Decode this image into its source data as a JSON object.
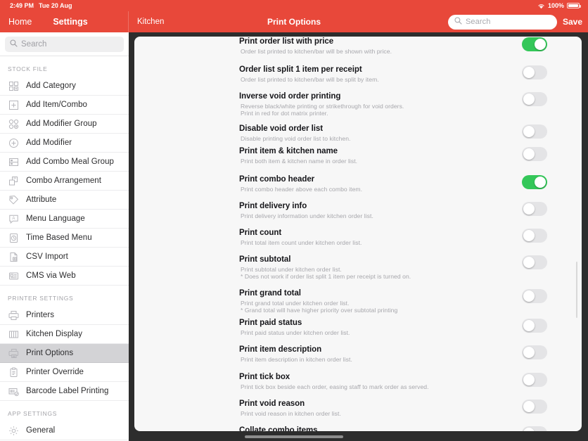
{
  "statusbar": {
    "time": "2:49 PM",
    "date": "Tue 20 Aug",
    "wifi_icon": "wifi-icon",
    "battery_percent": "100%",
    "battery_icon": "battery-full-icon"
  },
  "navbar": {
    "home_label": "Home",
    "settings_label": "Settings",
    "section_label": "Kitchen",
    "title": "Print Options",
    "search_placeholder": "Search",
    "search_value": "",
    "search_icon": "search-icon",
    "save_label": "Save"
  },
  "sidebar": {
    "search_placeholder": "Search",
    "search_value": "",
    "search_icon": "search-icon",
    "sections": [
      {
        "header": "STOCK FILE",
        "items": [
          {
            "label": "Add Category",
            "icon": "grid-add-icon",
            "selected": false
          },
          {
            "label": "Add Item/Combo",
            "icon": "plus-square-icon",
            "selected": false
          },
          {
            "label": "Add Modifier Group",
            "icon": "circles-add-icon",
            "selected": false
          },
          {
            "label": "Add Modifier",
            "icon": "plus-circle-icon",
            "selected": false
          },
          {
            "label": "Add Combo Meal Group",
            "icon": "combo-meal-icon",
            "selected": false
          },
          {
            "label": "Combo Arrangement",
            "icon": "arrange-icon",
            "selected": false
          },
          {
            "label": "Attribute",
            "icon": "tag-icon",
            "selected": false
          },
          {
            "label": "Menu Language",
            "icon": "speech-a-icon",
            "selected": false
          },
          {
            "label": "Time Based Menu",
            "icon": "clock-doc-icon",
            "selected": false
          },
          {
            "label": "CSV Import",
            "icon": "csv-file-icon",
            "selected": false
          },
          {
            "label": "CMS via Web",
            "icon": "web-card-icon",
            "selected": false
          }
        ]
      },
      {
        "header": "PRINTER SETTINGS",
        "items": [
          {
            "label": "Printers",
            "icon": "printer-icon",
            "selected": false
          },
          {
            "label": "Kitchen Display",
            "icon": "kds-columns-icon",
            "selected": false
          },
          {
            "label": "Print Options",
            "icon": "printer-options-icon",
            "selected": true
          },
          {
            "label": "Printer Override",
            "icon": "clipboard-icon",
            "selected": false
          },
          {
            "label": "Barcode Label Printing",
            "icon": "barcode-label-icon",
            "selected": false
          }
        ]
      },
      {
        "header": "APP SETTINGS",
        "items": [
          {
            "label": "General",
            "icon": "gear-icon",
            "selected": false
          }
        ]
      }
    ]
  },
  "colors": {
    "brand_red": "#e8483a",
    "toggle_on": "#34c759",
    "toggle_off": "#e4e4e6",
    "panel_bg": "#f7f7f7",
    "sidebar_selected": "#d3d3d6"
  },
  "main": {
    "options": [
      {
        "title": "Print order list with price",
        "desc": [
          "Order list printed to kitchen/bar will be shown with price."
        ],
        "state": "on"
      },
      {
        "title": "Order list split 1 item per receipt",
        "desc": [
          "Order list printed to kitchen/bar will be split by item."
        ],
        "state": "off"
      },
      {
        "title": "Inverse void order printing",
        "desc": [
          "Reverse black/white printing or strikethrough for void orders.",
          "Print in red for dot matrix printer."
        ],
        "state": "off"
      },
      {
        "title": "Disable void order list",
        "desc": [
          "Disable printing void order list to kitchen."
        ],
        "state": "off"
      },
      {
        "title": "Print item & kitchen name",
        "desc": [
          "Print both item & kitchen name in order list."
        ],
        "state": "off"
      },
      {
        "title": "Print combo header",
        "desc": [
          "Print combo header above each combo item."
        ],
        "state": "on"
      },
      {
        "title": "Print delivery info",
        "desc": [
          "Print delivery information under kitchen order list."
        ],
        "state": "off"
      },
      {
        "title": "Print count",
        "desc": [
          "Print total item count under kitchen order list."
        ],
        "state": "off"
      },
      {
        "title": "Print subtotal",
        "desc": [
          "Print subtotal under kitchen order list.",
          "* Does not work if order list split 1 item per receipt is turned on."
        ],
        "state": "off"
      },
      {
        "title": "Print grand total",
        "desc": [
          "Print grand total under kitchen order list.",
          "* Grand total will have higher priority over subtotal printing"
        ],
        "state": "off"
      },
      {
        "title": "Print paid status",
        "desc": [
          "Print paid status under kitchen order list."
        ],
        "state": "off"
      },
      {
        "title": "Print item description",
        "desc": [
          "Print item description in kitchen order list."
        ],
        "state": "off"
      },
      {
        "title": "Print tick box",
        "desc": [
          "Print tick box beside each order, easing staff to mark order as served."
        ],
        "state": "off"
      },
      {
        "title": "Print void reason",
        "desc": [
          "Print void reason in kitchen order list."
        ],
        "state": "off"
      },
      {
        "title": "Collate combo items",
        "desc": [],
        "state": "off"
      }
    ]
  }
}
